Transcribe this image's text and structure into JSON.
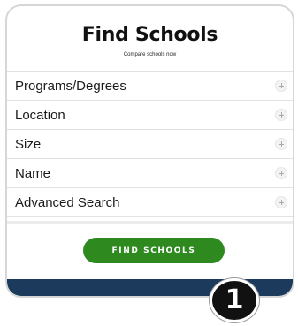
{
  "header": {
    "title": "Find Schools",
    "subtitle": "Compare schools now"
  },
  "filters": [
    {
      "label": "Programs/Degrees",
      "icon": "plus-icon"
    },
    {
      "label": "Location",
      "icon": "plus-icon"
    },
    {
      "label": "Size",
      "icon": "plus-icon"
    },
    {
      "label": "Name",
      "icon": "plus-icon"
    },
    {
      "label": "Advanced Search",
      "icon": "plus-icon"
    }
  ],
  "action": {
    "find_label": "FIND SCHOOLS"
  },
  "badge": {
    "number": "1"
  },
  "colors": {
    "accent": "#2e8a1f",
    "footer": "#1b3a5c",
    "badge": "#111111"
  }
}
